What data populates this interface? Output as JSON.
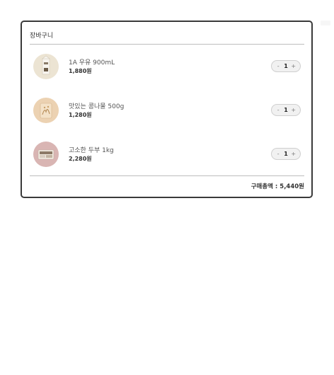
{
  "cart": {
    "title": "장바구니",
    "items": [
      {
        "name": "1A 우유 900mL",
        "price": "1,880원",
        "quantity": "1",
        "thumbnail_icon": "milk-carton-icon"
      },
      {
        "name": "맛있는 콩나물 500g",
        "price": "1,280원",
        "quantity": "1",
        "thumbnail_icon": "bean-sprouts-icon"
      },
      {
        "name": "고소한 두부 1kg",
        "price": "2,280원",
        "quantity": "1",
        "thumbnail_icon": "tofu-pack-icon"
      }
    ],
    "stepper": {
      "minus": "-",
      "plus": "+"
    },
    "total_label": "구매총액 : 5,440원"
  },
  "colors": {
    "border": "#3a3a3a",
    "divider": "#bdbdbd",
    "stepper_bg": "#f1f1f1"
  }
}
